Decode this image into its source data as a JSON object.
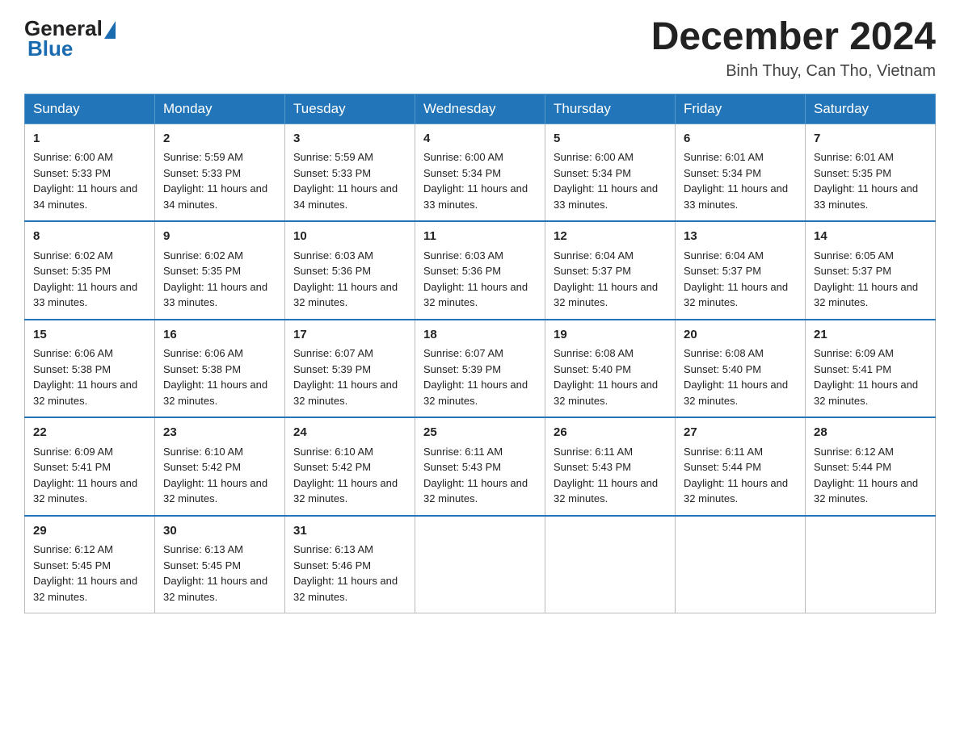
{
  "header": {
    "logo_general": "General",
    "logo_blue": "Blue",
    "month_year": "December 2024",
    "location": "Binh Thuy, Can Tho, Vietnam"
  },
  "days_of_week": [
    "Sunday",
    "Monday",
    "Tuesday",
    "Wednesday",
    "Thursday",
    "Friday",
    "Saturday"
  ],
  "weeks": [
    [
      {
        "day": 1,
        "sunrise": "6:00 AM",
        "sunset": "5:33 PM",
        "daylight": "11 hours and 34 minutes."
      },
      {
        "day": 2,
        "sunrise": "5:59 AM",
        "sunset": "5:33 PM",
        "daylight": "11 hours and 34 minutes."
      },
      {
        "day": 3,
        "sunrise": "5:59 AM",
        "sunset": "5:33 PM",
        "daylight": "11 hours and 34 minutes."
      },
      {
        "day": 4,
        "sunrise": "6:00 AM",
        "sunset": "5:34 PM",
        "daylight": "11 hours and 33 minutes."
      },
      {
        "day": 5,
        "sunrise": "6:00 AM",
        "sunset": "5:34 PM",
        "daylight": "11 hours and 33 minutes."
      },
      {
        "day": 6,
        "sunrise": "6:01 AM",
        "sunset": "5:34 PM",
        "daylight": "11 hours and 33 minutes."
      },
      {
        "day": 7,
        "sunrise": "6:01 AM",
        "sunset": "5:35 PM",
        "daylight": "11 hours and 33 minutes."
      }
    ],
    [
      {
        "day": 8,
        "sunrise": "6:02 AM",
        "sunset": "5:35 PM",
        "daylight": "11 hours and 33 minutes."
      },
      {
        "day": 9,
        "sunrise": "6:02 AM",
        "sunset": "5:35 PM",
        "daylight": "11 hours and 33 minutes."
      },
      {
        "day": 10,
        "sunrise": "6:03 AM",
        "sunset": "5:36 PM",
        "daylight": "11 hours and 32 minutes."
      },
      {
        "day": 11,
        "sunrise": "6:03 AM",
        "sunset": "5:36 PM",
        "daylight": "11 hours and 32 minutes."
      },
      {
        "day": 12,
        "sunrise": "6:04 AM",
        "sunset": "5:37 PM",
        "daylight": "11 hours and 32 minutes."
      },
      {
        "day": 13,
        "sunrise": "6:04 AM",
        "sunset": "5:37 PM",
        "daylight": "11 hours and 32 minutes."
      },
      {
        "day": 14,
        "sunrise": "6:05 AM",
        "sunset": "5:37 PM",
        "daylight": "11 hours and 32 minutes."
      }
    ],
    [
      {
        "day": 15,
        "sunrise": "6:06 AM",
        "sunset": "5:38 PM",
        "daylight": "11 hours and 32 minutes."
      },
      {
        "day": 16,
        "sunrise": "6:06 AM",
        "sunset": "5:38 PM",
        "daylight": "11 hours and 32 minutes."
      },
      {
        "day": 17,
        "sunrise": "6:07 AM",
        "sunset": "5:39 PM",
        "daylight": "11 hours and 32 minutes."
      },
      {
        "day": 18,
        "sunrise": "6:07 AM",
        "sunset": "5:39 PM",
        "daylight": "11 hours and 32 minutes."
      },
      {
        "day": 19,
        "sunrise": "6:08 AM",
        "sunset": "5:40 PM",
        "daylight": "11 hours and 32 minutes."
      },
      {
        "day": 20,
        "sunrise": "6:08 AM",
        "sunset": "5:40 PM",
        "daylight": "11 hours and 32 minutes."
      },
      {
        "day": 21,
        "sunrise": "6:09 AM",
        "sunset": "5:41 PM",
        "daylight": "11 hours and 32 minutes."
      }
    ],
    [
      {
        "day": 22,
        "sunrise": "6:09 AM",
        "sunset": "5:41 PM",
        "daylight": "11 hours and 32 minutes."
      },
      {
        "day": 23,
        "sunrise": "6:10 AM",
        "sunset": "5:42 PM",
        "daylight": "11 hours and 32 minutes."
      },
      {
        "day": 24,
        "sunrise": "6:10 AM",
        "sunset": "5:42 PM",
        "daylight": "11 hours and 32 minutes."
      },
      {
        "day": 25,
        "sunrise": "6:11 AM",
        "sunset": "5:43 PM",
        "daylight": "11 hours and 32 minutes."
      },
      {
        "day": 26,
        "sunrise": "6:11 AM",
        "sunset": "5:43 PM",
        "daylight": "11 hours and 32 minutes."
      },
      {
        "day": 27,
        "sunrise": "6:11 AM",
        "sunset": "5:44 PM",
        "daylight": "11 hours and 32 minutes."
      },
      {
        "day": 28,
        "sunrise": "6:12 AM",
        "sunset": "5:44 PM",
        "daylight": "11 hours and 32 minutes."
      }
    ],
    [
      {
        "day": 29,
        "sunrise": "6:12 AM",
        "sunset": "5:45 PM",
        "daylight": "11 hours and 32 minutes."
      },
      {
        "day": 30,
        "sunrise": "6:13 AM",
        "sunset": "5:45 PM",
        "daylight": "11 hours and 32 minutes."
      },
      {
        "day": 31,
        "sunrise": "6:13 AM",
        "sunset": "5:46 PM",
        "daylight": "11 hours and 32 minutes."
      },
      null,
      null,
      null,
      null
    ]
  ]
}
